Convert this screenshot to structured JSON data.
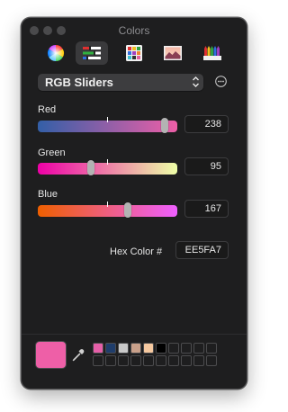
{
  "window": {
    "title": "Colors"
  },
  "toolbar": {
    "tabs": [
      {
        "name": "color-wheel",
        "icon": "color-wheel-icon"
      },
      {
        "name": "color-sliders",
        "icon": "sliders-icon",
        "selected": true
      },
      {
        "name": "color-palettes",
        "icon": "palette-icon"
      },
      {
        "name": "image-palettes",
        "icon": "image-icon"
      },
      {
        "name": "pencils",
        "icon": "pencils-icon"
      }
    ]
  },
  "mode_popup": {
    "label": "RGB Sliders"
  },
  "sliders": [
    {
      "label": "Red",
      "value": "238",
      "fraction": 0.933,
      "gradient": [
        "#335FA7",
        "#EE5FA7"
      ]
    },
    {
      "label": "Green",
      "value": "95",
      "fraction": 0.373,
      "gradient": [
        "#EE00A7",
        "#EEFFA7"
      ]
    },
    {
      "label": "Blue",
      "value": "167",
      "fraction": 0.655,
      "gradient": [
        "#EE5F00",
        "#EE5FFF"
      ]
    }
  ],
  "hex": {
    "label": "Hex Color #",
    "value": "EE5FA7"
  },
  "current_color": "#EE5FA7",
  "saved_swatches": [
    "#E55FA8",
    "#1F3D6B",
    "#C9C9C9",
    "#C9A08A",
    "#F6C9A0",
    "#000000"
  ]
}
